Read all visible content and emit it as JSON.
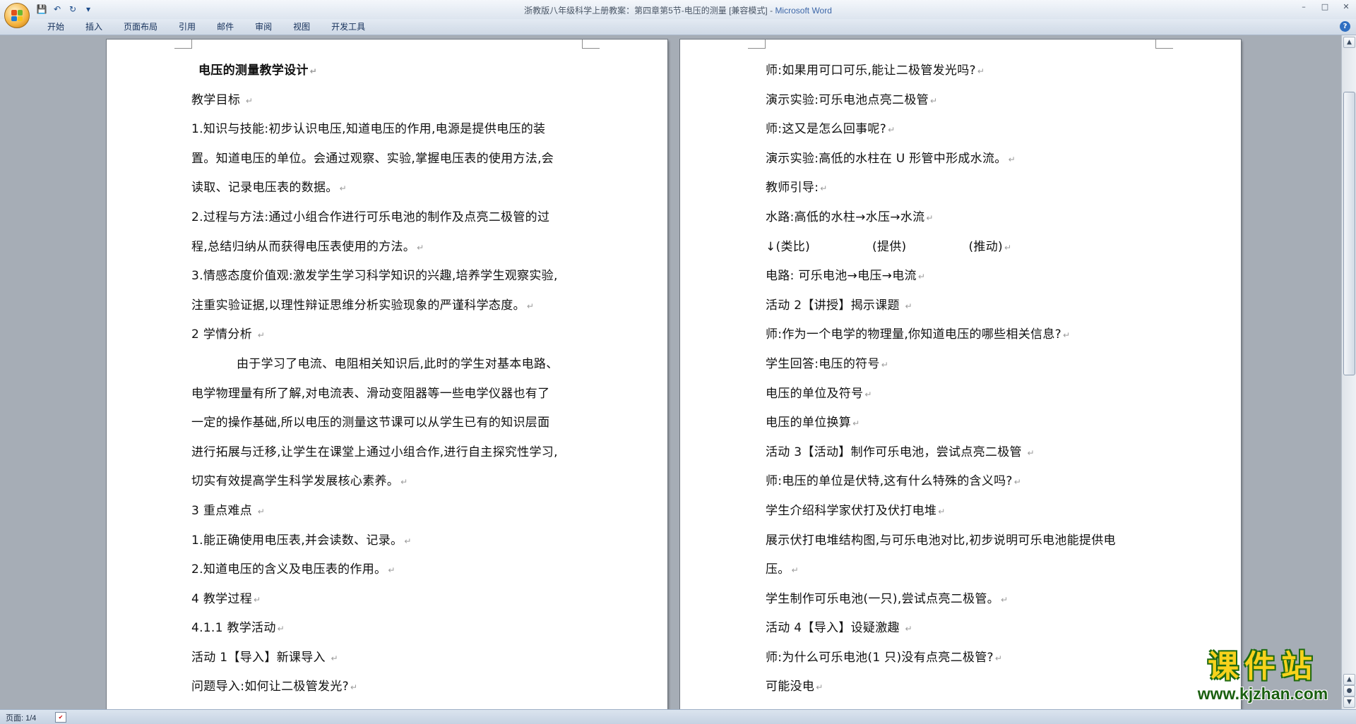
{
  "window": {
    "title": "浙教版八年级科学上册教案：第四章第5节-电压的测量 [兼容模式] - ",
    "app_name": "Microsoft Word",
    "controls": [
      "–",
      "□",
      "✕"
    ]
  },
  "quick_access": {
    "save": "💾",
    "undo": "↶",
    "redo": "↻",
    "more": "▾"
  },
  "ribbon": {
    "tabs": [
      "开始",
      "插入",
      "页面布局",
      "引用",
      "邮件",
      "审阅",
      "视图",
      "开发工具"
    ],
    "help": "?"
  },
  "page1": {
    "lines": [
      "电压的测量教学设计",
      "教学目标 ",
      "1.知识与技能:初步认识电压,知道电压的作用,电源是提供电压的装",
      "置。知道电压的单位。会通过观察、实验,掌握电压表的使用方法,会",
      "读取、记录电压表的数据。",
      "2.过程与方法:通过小组合作进行可乐电池的制作及点亮二极管的过",
      "程,总结归纳从而获得电压表使用的方法。",
      "3.情感态度价值观:激发学生学习科学知识的兴趣,培养学生观察实验,",
      "注重实验证据,以理性辩证思维分析实验现象的严谨科学态度。",
      "2 学情分析 ",
      "由于学习了电流、电阻相关知识后,此时的学生对基本电路、",
      "电学物理量有所了解,对电流表、滑动变阻器等一些电学仪器也有了",
      "一定的操作基础,所以电压的测量这节课可以从学生已有的知识层面",
      "进行拓展与迁移,让学生在课堂上通过小组合作,进行自主探究性学习,",
      "切实有效提高学生科学发展核心素养。",
      "3 重点难点 ",
      "1.能正确使用电压表,并会读数、记录。",
      "2.知道电压的含义及电压表的作用。",
      "4 教学过程",
      "4.1.1 教学活动",
      "活动 1【导入】新课导入 ",
      "问题导入:如何让二极管发光?"
    ]
  },
  "page2": {
    "lines": [
      "师:如果用可口可乐,能让二极管发光吗?",
      "演示实验:可乐电池点亮二极管",
      "师:这又是怎么回事呢?",
      "演示实验:高低的水柱在 U 形管中形成水流。",
      "教师引导:",
      "水路:高低的水柱→水压→水流",
      "↓(类比)",
      "(提供)",
      "(推动)",
      "电路: 可乐电池→电压→电流",
      "活动 2【讲授】揭示课题 ",
      "师:作为一个电学的物理量,你知道电压的哪些相关信息?",
      "学生回答:电压的符号",
      "电压的单位及符号",
      "电压的单位换算",
      "活动 3【活动】制作可乐电池，尝试点亮二极管 ",
      "师:电压的单位是伏特,这有什么特殊的含义吗?",
      "学生介绍科学家伏打及伏打电堆",
      "展示伏打电堆结构图,与可乐电池对比,初步说明可乐电池能提供电",
      "压。",
      "学生制作可乐电池(一只),尝试点亮二极管。",
      "活动 4【导入】设疑激趣 ",
      "师:为什么可乐电池(1 只)没有点亮二极管?",
      "可能没电"
    ]
  },
  "paragraph_mark": "↵",
  "status": {
    "page": "页面: 1/4"
  },
  "watermark": {
    "title": "课件站",
    "url": "www.kjzhan.com"
  }
}
